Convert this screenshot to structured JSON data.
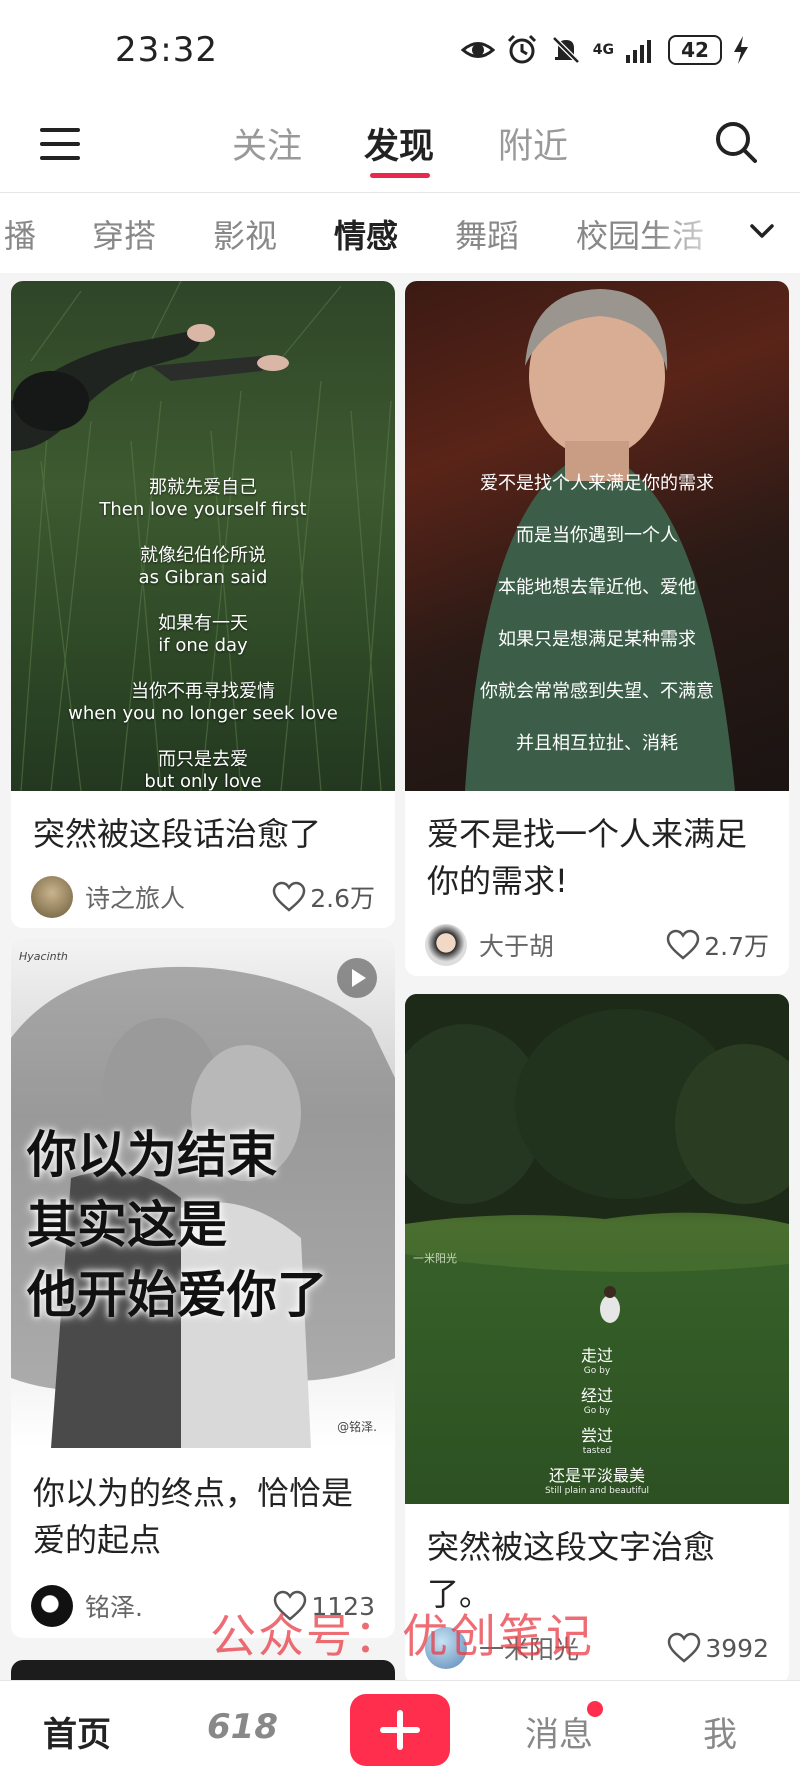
{
  "status_bar": {
    "time": "23:32",
    "network": "4G",
    "battery": "42"
  },
  "top_nav": {
    "tabs": [
      "关注",
      "发现",
      "附近"
    ],
    "active_tab": "发现"
  },
  "categories": {
    "items": [
      "播",
      "穿搭",
      "影视",
      "情感",
      "舞蹈",
      "校园生活"
    ],
    "active": "情感"
  },
  "cards": [
    {
      "title": "突然被这段话治愈了",
      "author": "诗之旅人",
      "likes": "2.6万",
      "cover_text": [
        {
          "zh": "那就先爱自己",
          "en": "Then love yourself first"
        },
        {
          "zh": "就像纪伯伦所说",
          "en": "as Gibran said"
        },
        {
          "zh": "如果有一天",
          "en": "if one day"
        },
        {
          "zh": "当你不再寻找爱情",
          "en": "when you no longer seek love"
        },
        {
          "zh": "而只是去爱",
          "en": "but only love"
        }
      ]
    },
    {
      "title": "爱不是找一个人来满足你的需求!",
      "author": "大于胡",
      "likes": "2.7万",
      "cover_captions": [
        "爱不是找个人来满足你的需求",
        "而是当你遇到一个人",
        "本能地想去靠近他、爱他",
        "如果只是想满足某种需求",
        "你就会常常感到失望、不满意",
        "并且相互拉扯、消耗"
      ]
    },
    {
      "title": "你以为的终点，恰恰是爱的起点",
      "author": "铭泽.",
      "likes": "1123",
      "cover_big_text": [
        "你以为结束",
        "其实这是",
        "他开始爱你了"
      ],
      "cover_signature": "@铭泽."
    },
    {
      "title": "突然被这段文字治愈了。",
      "author": "一米阳光",
      "likes": "3992",
      "cover_logo": "一米阳光",
      "cover_text": [
        {
          "zh": "走过",
          "en": "Go by"
        },
        {
          "zh": "经过",
          "en": "Go by"
        },
        {
          "zh": "尝过",
          "en": "tasted"
        },
        {
          "zh": "还是平淡最美",
          "en": "Still plain and beautiful"
        }
      ]
    }
  ],
  "watermark": "公众号：优创笔记",
  "bottom_nav": {
    "home": "首页",
    "promo": "618",
    "messages": "消息",
    "me": "我"
  },
  "colors": {
    "accent": "#e8294c",
    "plus": "#ff2e4d"
  }
}
